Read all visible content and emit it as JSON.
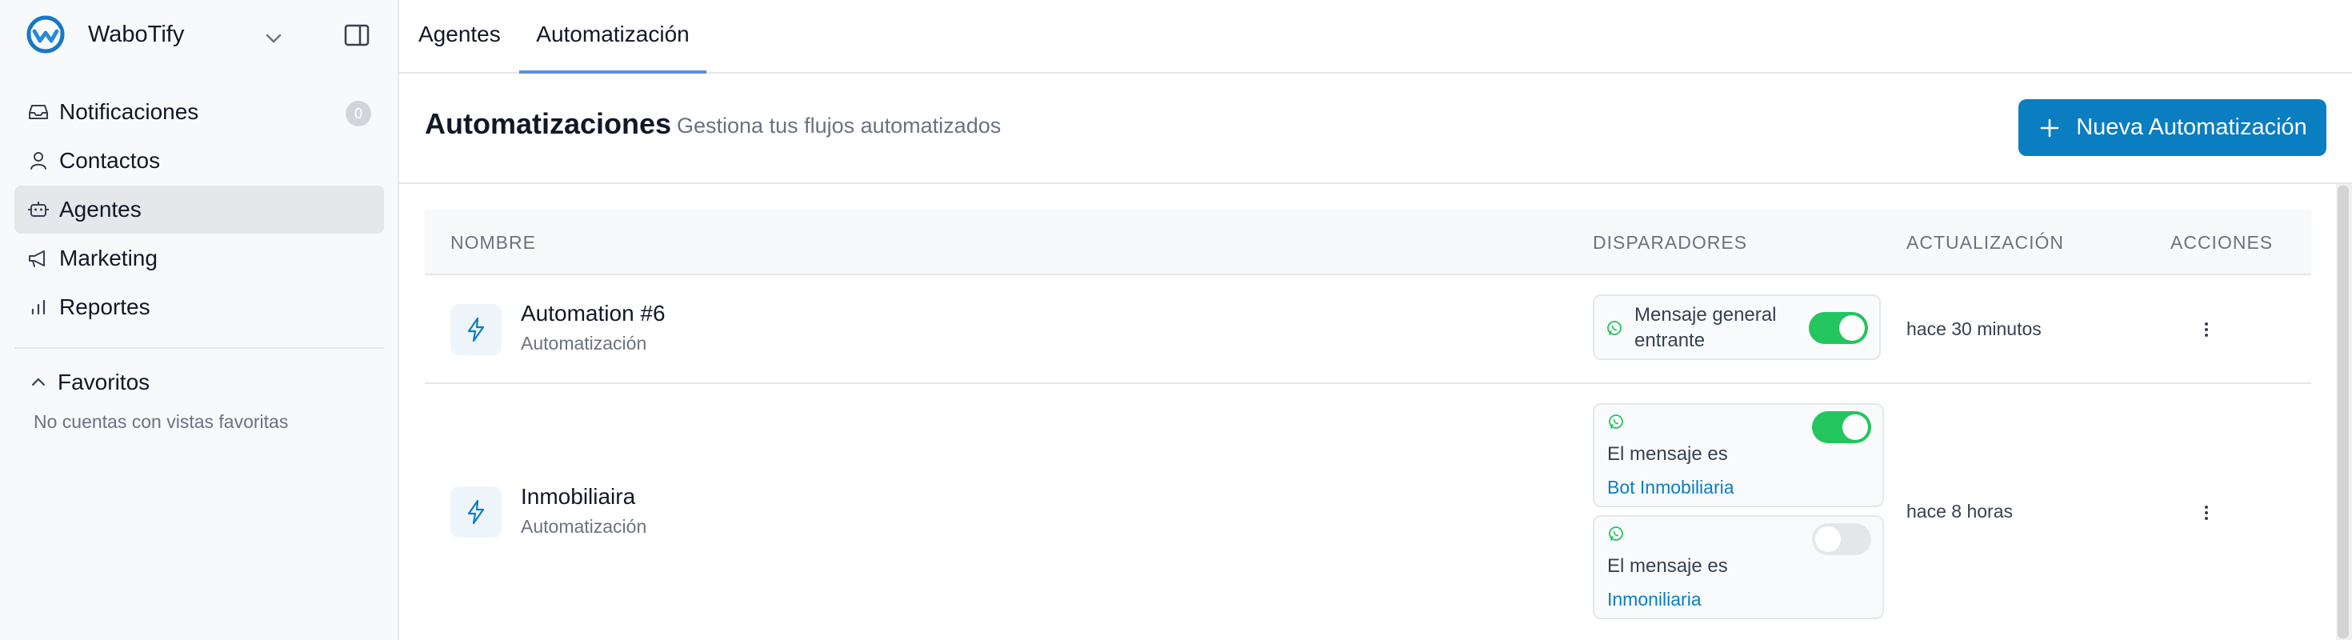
{
  "brand": {
    "name": "WaboTify",
    "logo_icon": "wabotify-logo-icon"
  },
  "sidebar": {
    "items": [
      {
        "label": "Notificaciones",
        "icon": "inbox-icon",
        "badge": "0"
      },
      {
        "label": "Contactos",
        "icon": "user-icon"
      },
      {
        "label": "Agentes",
        "icon": "bot-icon",
        "active": true
      },
      {
        "label": "Marketing",
        "icon": "megaphone-icon"
      },
      {
        "label": "Reportes",
        "icon": "bar-chart-icon"
      }
    ],
    "favorites_title": "Favoritos",
    "favorites_empty": "No cuentas con vistas favoritas"
  },
  "tabs": [
    {
      "label": "Agentes"
    },
    {
      "label": "Automatización",
      "active": true
    }
  ],
  "header": {
    "title": "Automatizaciones",
    "subtitle": "Gestiona tus flujos automatizados",
    "new_button": "Nueva Automatización"
  },
  "table": {
    "columns": [
      "NOMBRE",
      "DISPARADORES",
      "ACTUALIZACIÓN",
      "ACCIONES"
    ],
    "rows": [
      {
        "name": "Automation #6",
        "type": "Automatización",
        "updated": "hace 30 minutos",
        "triggers": [
          {
            "line1": "Mensaje general",
            "line2": "entrante",
            "enabled": true
          }
        ]
      },
      {
        "name": "Inmobiliaira",
        "type": "Automatización",
        "updated": "hace 8 horas",
        "triggers": [
          {
            "text": "El mensaje es",
            "value": "Bot Inmobiliaria",
            "enabled": true
          },
          {
            "text": "El mensaje es",
            "value": "Inmoniliaria",
            "enabled": false
          }
        ]
      }
    ]
  },
  "colors": {
    "accent": "#0b7dc1",
    "toggle_on": "#22c55e",
    "whatsapp": "#22c55e",
    "tab_underline": "#5b8fd9"
  }
}
